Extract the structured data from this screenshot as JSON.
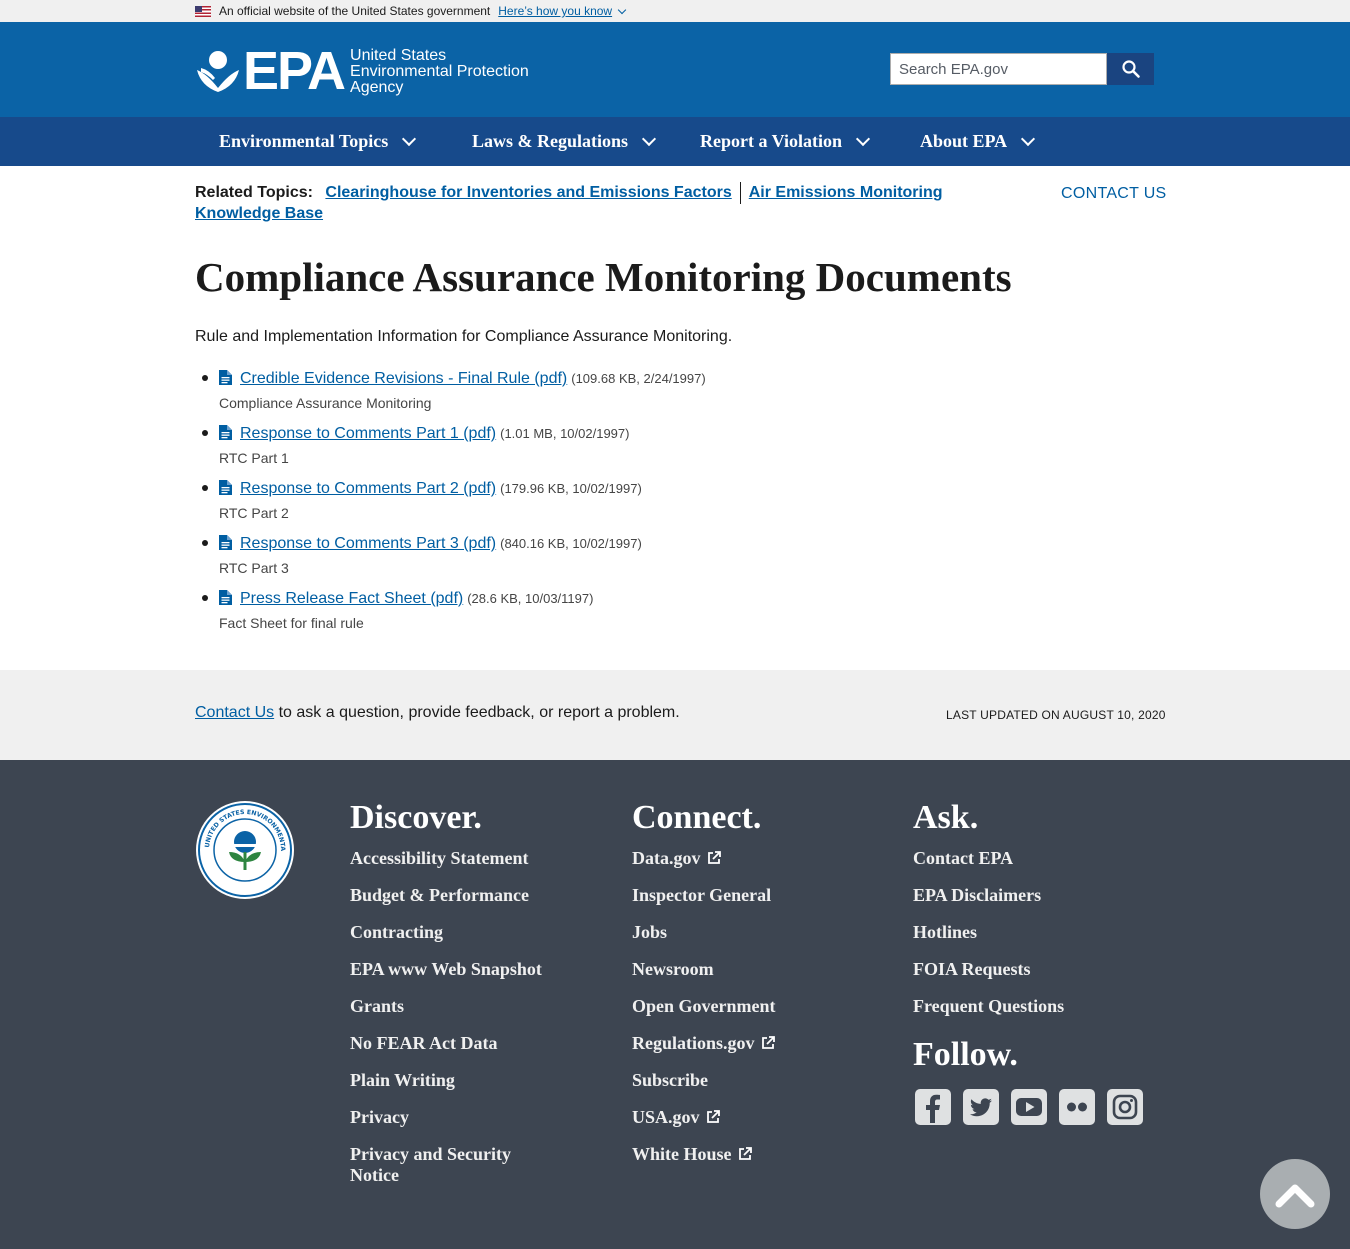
{
  "gov_banner": {
    "text": "An official website of the United States government",
    "link": "Here’s how you know"
  },
  "header": {
    "logo_text": "EPA",
    "agency_line1": "United States",
    "agency_line2": "Environmental Protection",
    "agency_line3": "Agency",
    "search_placeholder": "Search EPA.gov"
  },
  "nav": {
    "items": [
      "Environmental Topics",
      "Laws & Regulations",
      "Report a Violation",
      "About EPA"
    ]
  },
  "related": {
    "label": "Related Topics:",
    "links": [
      "Clearinghouse for Inventories and Emissions Factors",
      "Air Emissions Monitoring Knowledge Base"
    ]
  },
  "contact_top": "CONTACT US",
  "page_title": "Compliance Assurance Monitoring Documents",
  "intro": "Rule and Implementation Information for Compliance Assurance Monitoring.",
  "documents": [
    {
      "title": "Credible Evidence Revisions - Final Rule (pdf)",
      "meta": "(109.68 KB, 2/24/1997)",
      "desc": "Compliance Assurance Monitoring"
    },
    {
      "title": "Response to Comments Part 1 (pdf)",
      "meta": "(1.01 MB, 10/02/1997)",
      "desc": "RTC Part 1"
    },
    {
      "title": "Response to Comments Part 2 (pdf)",
      "meta": "(179.96 KB, 10/02/1997)",
      "desc": "RTC Part 2"
    },
    {
      "title": "Response to Comments Part 3 (pdf)",
      "meta": "(840.16 KB, 10/02/1997)",
      "desc": "RTC Part 3"
    },
    {
      "title": "Press Release Fact Sheet (pdf)",
      "meta": "(28.6 KB, 10/03/1197)",
      "desc": "Fact Sheet for final rule"
    }
  ],
  "feedback": {
    "link": "Contact Us",
    "text": " to ask a question, provide feedback, or report a problem.",
    "updated": "LAST UPDATED ON AUGUST 10, 2020"
  },
  "footer": {
    "discover": {
      "heading": "Discover.",
      "links": [
        "Accessibility Statement",
        "Budget & Performance",
        "Contracting",
        "EPA www Web Snapshot",
        "Grants",
        "No FEAR Act Data",
        "Plain Writing",
        "Privacy",
        "Privacy and Security Notice"
      ]
    },
    "connect": {
      "heading": "Connect.",
      "links": [
        {
          "label": "Data.gov",
          "external": true
        },
        {
          "label": "Inspector General",
          "external": false
        },
        {
          "label": "Jobs",
          "external": false
        },
        {
          "label": "Newsroom",
          "external": false
        },
        {
          "label": "Open Government",
          "external": false
        },
        {
          "label": "Regulations.gov",
          "external": true
        },
        {
          "label": "Subscribe",
          "external": false
        },
        {
          "label": "USA.gov",
          "external": true
        },
        {
          "label": "White House",
          "external": true
        }
      ]
    },
    "ask": {
      "heading": "Ask.",
      "links": [
        "Contact EPA",
        "EPA Disclaimers",
        "Hotlines",
        "FOIA Requests",
        "Frequent Questions"
      ]
    },
    "follow": {
      "heading": "Follow.",
      "icons": [
        "facebook-icon",
        "twitter-icon",
        "youtube-icon",
        "flickr-icon",
        "instagram-icon"
      ]
    },
    "seal_text": "UNITED STATES ENVIRONMENTAL PROTECTION AGENCY"
  },
  "colors": {
    "header_blue": "#0b63a6",
    "nav_blue": "#174a8b",
    "link_blue": "#005ea2",
    "footer_bg": "#3d4551"
  }
}
